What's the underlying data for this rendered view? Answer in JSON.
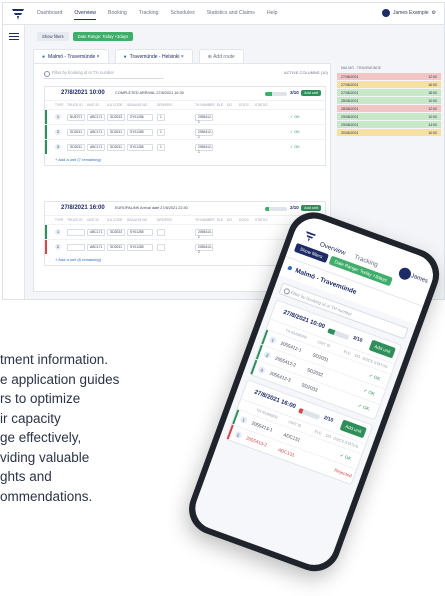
{
  "desktop": {
    "nav": [
      "Dashboard",
      "Overview",
      "Booking",
      "Tracking",
      "Schedules",
      "Statistics and Claims",
      "Help"
    ],
    "nav_active": 1,
    "user_name": "James Example",
    "filter_chips": [
      "Show filters",
      "Date Range: Today +3days"
    ],
    "route_tabs": [
      "Malmö - Travemünde",
      "Travemünde - Helsinki"
    ],
    "add_route": "Add route",
    "search_placeholder": "Filter by booking id or TH number",
    "active_columns": "ACTIVE COLUMNS (10)",
    "right_table_header": "MALMÖ - TRAVEMÜNDE",
    "columns": [
      "TYPE",
      "TRUCK ID",
      "UNIT ID",
      "ILU CODE",
      "SEALING NO",
      "DRIVERS",
      "TH NUMBER",
      "ELE",
      "DG",
      "DOCS",
      "STATUS"
    ],
    "groups": [
      {
        "date": "27/8/2021 10:00",
        "chip": "COMPLETED  ARRIVAL 27/8/2021 16:30",
        "count": "3/10",
        "progress": 0.3,
        "add_label": "Add unit",
        "rows": [
          {
            "num": "1",
            "truck": "BUE271",
            "unit": "ABC171",
            "ilu": "SD2033",
            "seal": "SY01286",
            "drivers": "1",
            "th": "2055412-1",
            "status": "OK",
            "strip": "#2f8f5a"
          },
          {
            "num": "2",
            "truck": "SD2031",
            "unit": "ABC171",
            "ilu": "SD2031",
            "seal": "SY01285",
            "drivers": "1",
            "th": "2055412-1",
            "status": "OK",
            "strip": "#2f8f5a"
          },
          {
            "num": "3",
            "truck": "SD2031",
            "unit": "ABC171",
            "ilu": "SD2031",
            "seal": "SY01285",
            "drivers": "1",
            "th": "2055412-1",
            "status": "OK",
            "strip": "#2f8f5a"
          }
        ],
        "add_unit_text": "+ Add a unit (7 remaining)"
      },
      {
        "date": "27/8/2021 16:00",
        "chip": "EUROPALINK  Arrival date 27/8/2021 22:30",
        "count": "2/10",
        "progress": 0.2,
        "add_label": "Add unit",
        "rows": [
          {
            "num": "1",
            "truck": "",
            "unit": "ABC171",
            "ilu": "SD2033",
            "seal": "SY01285",
            "drivers": "",
            "th": "2055410-1",
            "status": "",
            "strip": "#2f8f5a"
          },
          {
            "num": "2",
            "truck": "",
            "unit": "ABC171",
            "ilu": "SD2031",
            "seal": "SY01285",
            "drivers": "",
            "th": "2055410-2",
            "status": "",
            "strip": "#d8454a"
          }
        ],
        "add_unit_text": "+ Add a unit (8 remaining)"
      }
    ],
    "right_rows": [
      {
        "a": "27/08/2021",
        "b": "12:00",
        "color": "#f3c6c6"
      },
      {
        "a": "27/08/2021",
        "b": "16:00",
        "color": "#f6e0a3"
      },
      {
        "a": "27/08/2021",
        "b": "18:00",
        "color": "#c9e8c9"
      },
      {
        "a": "28/08/2021",
        "b": "10:00",
        "color": "#c9e8c9"
      },
      {
        "a": "28/08/2021",
        "b": "12:00",
        "color": "#f3c6c6"
      },
      {
        "a": "29/08/2021",
        "b": "10:00",
        "color": "#c9e8c9"
      },
      {
        "a": "29/08/2021",
        "b": "14:00",
        "color": "#c9e8c9"
      },
      {
        "a": "30/08/2021",
        "b": "10:00",
        "color": "#f6e0a3"
      }
    ]
  },
  "paragraph": [
    "tment information.",
    "e application guides",
    "rs to optimize",
    "ir capacity",
    "ge effectively,",
    "viding valuable",
    "ghts and",
    "ommendations."
  ],
  "phone": {
    "nav": [
      "Overview",
      "Tracking"
    ],
    "user_name": "James",
    "chips": [
      "Show filters",
      "Date Range: Today +3days"
    ],
    "route": "Malmö - Travemünde",
    "search_placeholder": "Filter by booking id or TH number",
    "columns": [
      "TH NUMBER",
      "UNIT ID",
      "ELE",
      "DG",
      "DOCS",
      "STATUS"
    ],
    "groups": [
      {
        "date": "27/8/2021 10:00",
        "count": "3/10",
        "progress": 0.3,
        "bar_color": "#2f8f5a",
        "add_label": "Add unit",
        "rows": [
          {
            "num": "1",
            "th": "2055412-1",
            "unit": "SD2031",
            "status": "OK",
            "red": false
          },
          {
            "num": "2",
            "th": "2055412-2",
            "unit": "SD2032",
            "status": "OK",
            "red": false
          },
          {
            "num": "3",
            "th": "2055412-3",
            "unit": "SD2033",
            "status": "OK",
            "red": false
          }
        ]
      },
      {
        "date": "27/8/2021 16:00",
        "count": "2/10",
        "progress": 0.2,
        "bar_color": "#d8454a",
        "add_label": "Add unit",
        "rows": [
          {
            "num": "1",
            "th": "2055413-1",
            "unit": "ADC131",
            "status": "OK",
            "red": false
          },
          {
            "num": "2",
            "th": "2055413-2",
            "unit": "ADC131",
            "status": "Rejected",
            "red": true
          }
        ]
      }
    ]
  },
  "colors": {
    "brand": "#1d2b66",
    "accent_green": "#2f8f5a",
    "accent_red": "#d8454a",
    "link_blue": "#2a6dbd"
  }
}
